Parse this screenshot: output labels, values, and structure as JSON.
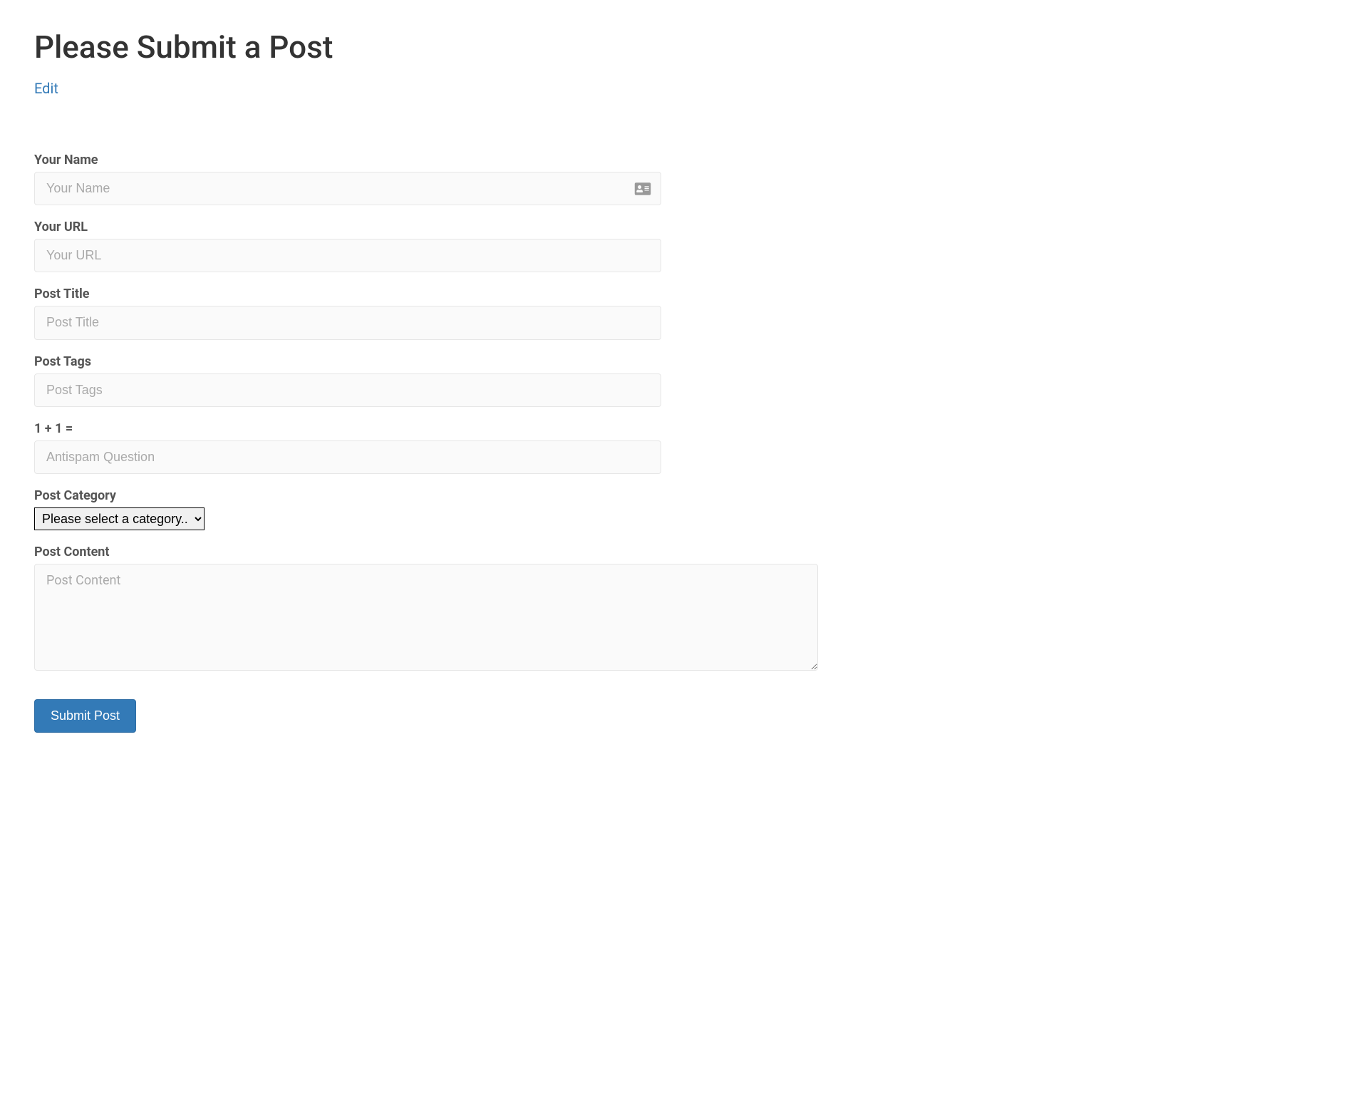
{
  "header": {
    "title": "Please Submit a Post",
    "edit_link": "Edit"
  },
  "form": {
    "name": {
      "label": "Your Name",
      "placeholder": "Your Name",
      "value": ""
    },
    "url": {
      "label": "Your URL",
      "placeholder": "Your URL",
      "value": ""
    },
    "post_title": {
      "label": "Post Title",
      "placeholder": "Post Title",
      "value": ""
    },
    "post_tags": {
      "label": "Post Tags",
      "placeholder": "Post Tags",
      "value": ""
    },
    "antispam": {
      "label": "1 + 1 =",
      "placeholder": "Antispam Question",
      "value": ""
    },
    "category": {
      "label": "Post Category",
      "selected": "Please select a category.."
    },
    "content": {
      "label": "Post Content",
      "placeholder": "Post Content",
      "value": ""
    },
    "submit_label": "Submit Post"
  },
  "icons": {
    "contact_card": "contact-card-icon"
  }
}
